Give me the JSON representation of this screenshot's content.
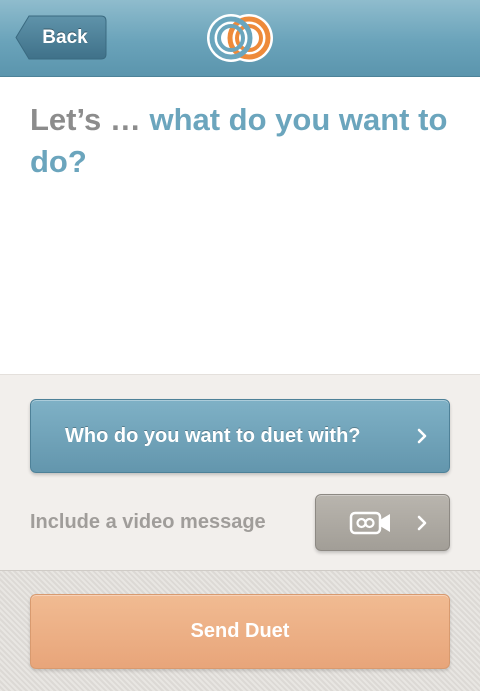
{
  "navbar": {
    "back_label": "Back",
    "logo_icon": "duet-rings-logo-icon"
  },
  "main": {
    "headline_lead": "Let’s …",
    "headline_rest": "what do you want to do?"
  },
  "options": {
    "who_label": "Who do you want to duet with?",
    "video_label": "Include a video message",
    "video_icon": "video-camera-icon",
    "chevron_icon": "chevron-right-icon"
  },
  "footer": {
    "send_label": "Send Duet"
  },
  "colors": {
    "navbar_blue": "#6aa3ba",
    "headline_blue": "#6ba5bd",
    "headline_gray": "#8c8c8c",
    "logo_orange": "#ee8a3a",
    "send_orange": "#eba97d",
    "video_button_gray": "#aaa69f"
  }
}
